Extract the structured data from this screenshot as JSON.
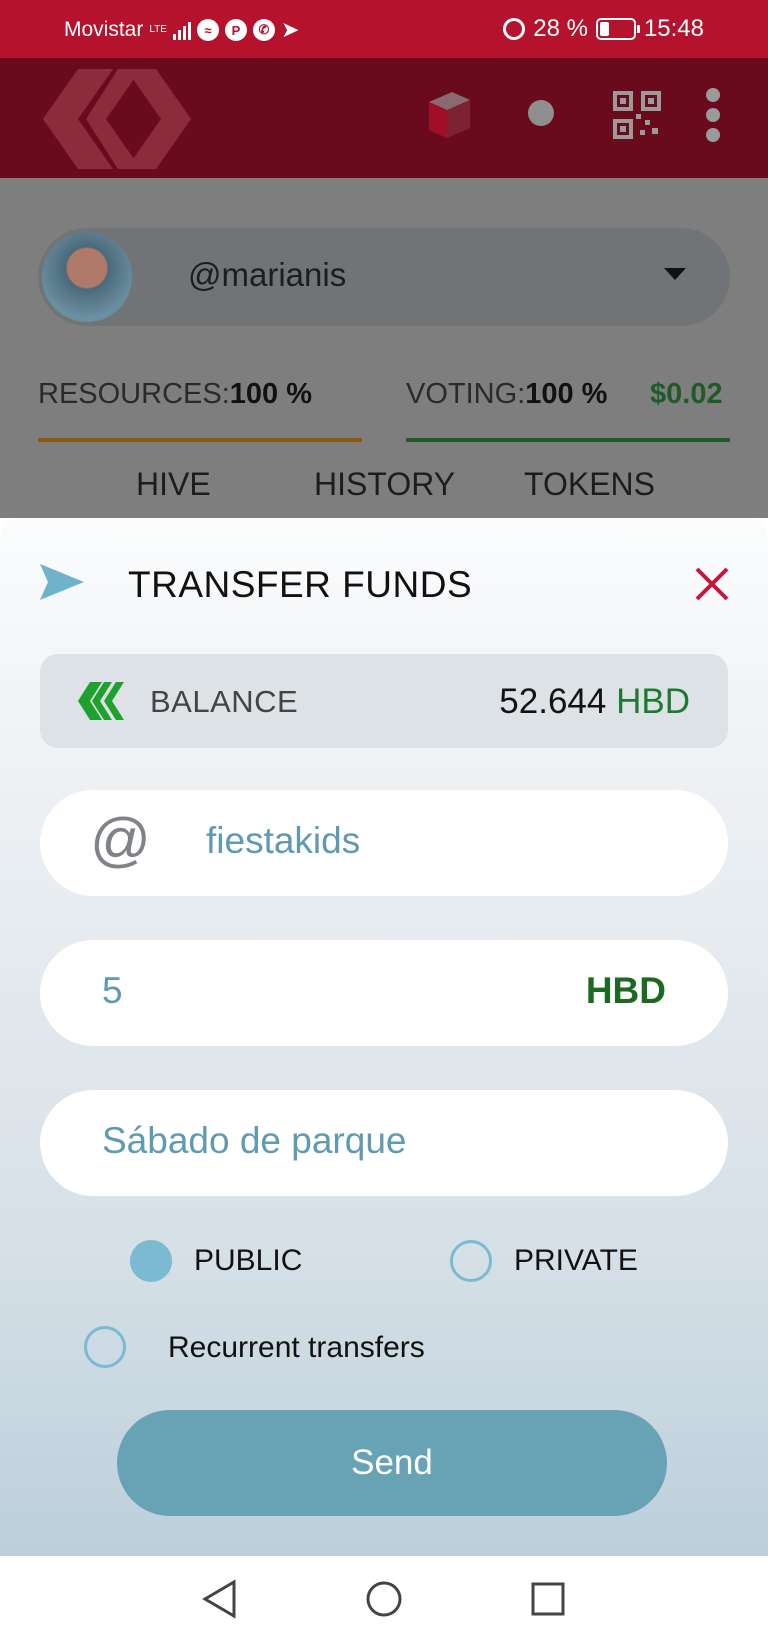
{
  "status_bar": {
    "carrier": "Movistar",
    "network": "LTE",
    "battery_percent": "28 %",
    "battery_level": 0.28,
    "time": "15:48"
  },
  "header": {
    "icons": [
      "hive-logo",
      "package-icon",
      "circle-icon",
      "qr-code-icon",
      "more-vert-icon"
    ]
  },
  "account": {
    "username": "@marianis"
  },
  "meters": {
    "resources_label": "RESOURCES:",
    "resources_value": "100 %",
    "voting_label": "VOTING:",
    "voting_value": "100 %",
    "voting_dollar": "$0.02"
  },
  "tabs": [
    "HIVE",
    "HISTORY",
    "TOKENS"
  ],
  "transfer": {
    "title": "TRANSFER FUNDS",
    "balance_label": "BALANCE",
    "balance_amount": "52.644",
    "balance_unit": "HBD",
    "recipient_at": "@",
    "recipient": "fiestakids",
    "amount": "5",
    "amount_currency": "HBD",
    "memo": "Sábado de parque",
    "public_label": "PUBLIC",
    "private_label": "PRIVATE",
    "recurrent_label": "Recurrent transfers",
    "visibility": "PUBLIC",
    "recurrent": false,
    "send_label": "Send"
  },
  "colors": {
    "brand_red": "#b5122e",
    "accent_blue": "#68a3b5",
    "hbd_green": "#1b6a1f",
    "close_red": "#c8163a"
  }
}
